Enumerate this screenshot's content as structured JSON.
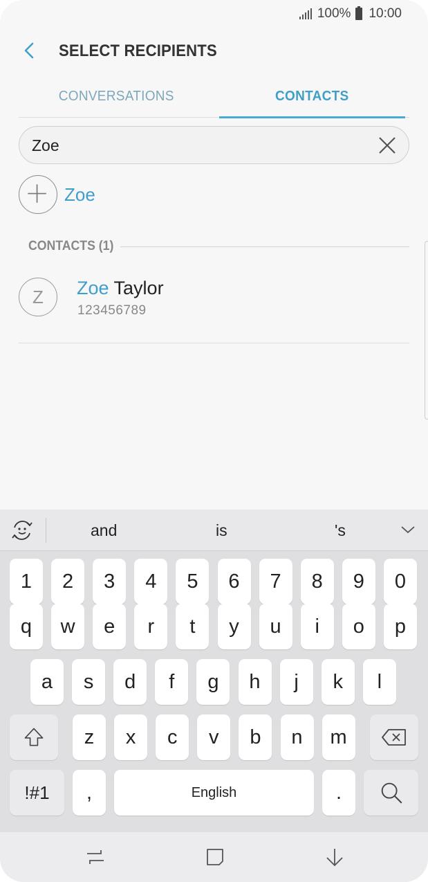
{
  "status_bar": {
    "battery": "100%",
    "time": "10:00"
  },
  "header": {
    "title": "SELECT RECIPIENTS"
  },
  "tabs": [
    {
      "label": "CONVERSATIONS",
      "active": false
    },
    {
      "label": "CONTACTS",
      "active": true
    }
  ],
  "search": {
    "value": "Zoe"
  },
  "add_recipient": {
    "label": "Zoe"
  },
  "contacts_section": {
    "label": "CONTACTS (1)"
  },
  "contacts": [
    {
      "initial": "Z",
      "name_match": "Zoe",
      "name_rest": " Taylor",
      "phone": "123456789"
    }
  ],
  "keyboard": {
    "suggestions": [
      "and",
      "is",
      "'s"
    ],
    "row_numbers": [
      "1",
      "2",
      "3",
      "4",
      "5",
      "6",
      "7",
      "8",
      "9",
      "0"
    ],
    "row_top": [
      "q",
      "w",
      "e",
      "r",
      "t",
      "y",
      "u",
      "i",
      "o",
      "p"
    ],
    "row_mid": [
      "a",
      "s",
      "d",
      "f",
      "g",
      "h",
      "j",
      "k",
      "l"
    ],
    "row_bottom": [
      "z",
      "x",
      "c",
      "v",
      "b",
      "n",
      "m"
    ],
    "symbols_label": "!#1",
    "comma_label": ",",
    "space_label": "English",
    "period_label": "."
  },
  "colors": {
    "accent": "#3f9fc9",
    "background": "#f7f7f7",
    "keyboard": "#dfdfe1"
  }
}
